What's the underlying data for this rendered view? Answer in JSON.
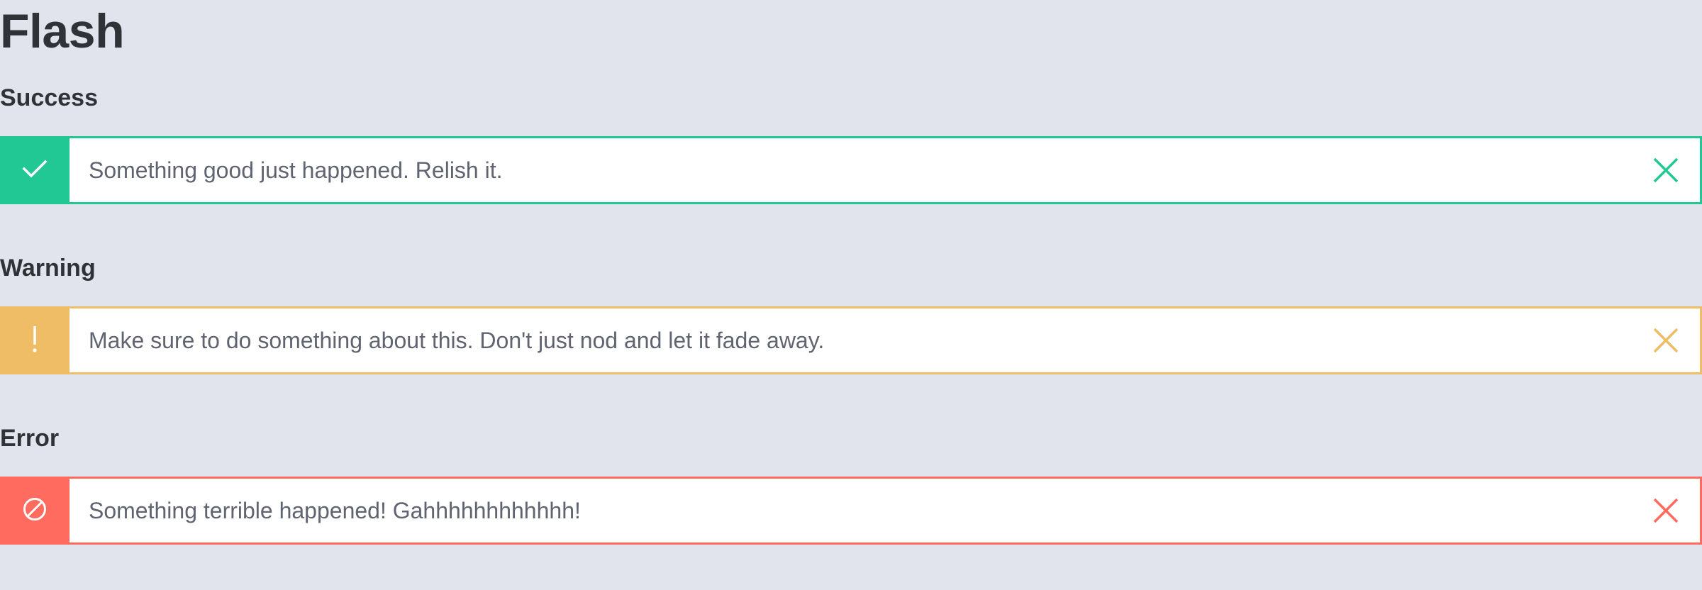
{
  "page": {
    "title": "Flash"
  },
  "flashes": [
    {
      "heading": "Success",
      "message": "Something good just happened. Relish it.",
      "icon": "check-icon",
      "color": "#22c893"
    },
    {
      "heading": "Warning",
      "message": "Make sure to do something about this. Don't just nod and let it fade away.",
      "icon": "exclamation-icon",
      "color": "#f0bd67"
    },
    {
      "heading": "Error",
      "message": "Something terrible happened! Gahhhhhhhhhhhh!",
      "icon": "prohibited-icon",
      "color": "#ff6b5f"
    }
  ],
  "close_icon": "close-icon",
  "colors": {
    "background": "#e1e4ec",
    "heading_text": "#2f3237",
    "message_text": "#5f6470"
  }
}
